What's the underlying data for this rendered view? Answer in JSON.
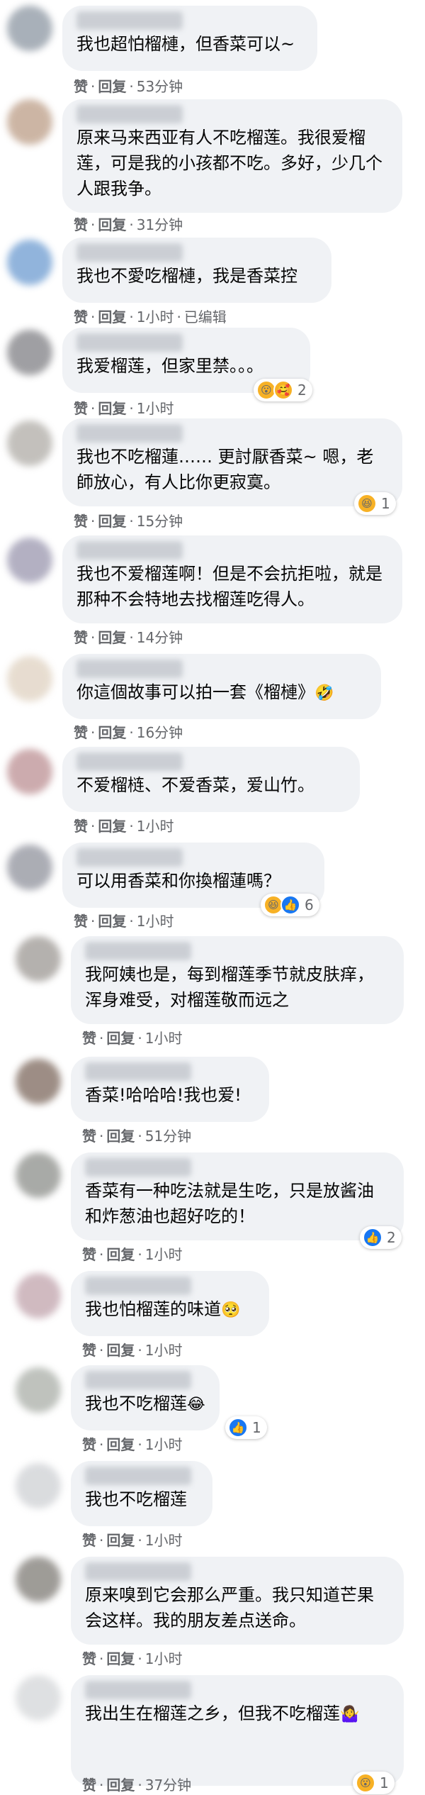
{
  "comments": [
    {
      "text": "我也超怕榴槤，但香菜可以~",
      "actions": [
        "赞",
        "回复"
      ],
      "time": "53分钟",
      "reactions": null
    },
    {
      "text": "原来马来西亚有人不吃榴莲。我很爱榴莲，可是我的小孩都不吃。多好，少几个人跟我争。",
      "actions": [
        "赞",
        "回复"
      ],
      "time": "31分钟",
      "reactions": null
    },
    {
      "text": "我也不愛吃榴槤，我是香菜控",
      "actions": [
        "赞",
        "回复"
      ],
      "time": "1小时",
      "extra": "已编辑",
      "reactions": null
    },
    {
      "text": "我爱榴莲，但家里禁。。。",
      "actions": [
        "赞",
        "回复"
      ],
      "time": "1小时",
      "reactions": {
        "icons": [
          "wow",
          "care"
        ],
        "count": "2"
      }
    },
    {
      "text": "我也不吃榴蓮…… 更討厭香菜~ 嗯，老師放心，有人比你更寂寞。",
      "actions": [
        "赞",
        "回复"
      ],
      "time": "15分钟",
      "reactions": {
        "icons": [
          "haha"
        ],
        "count": "1"
      }
    },
    {
      "text": "我也不爱榴莲啊！但是不会抗拒啦，就是那种不会特地去找榴莲吃得人。",
      "actions": [
        "赞",
        "回复"
      ],
      "time": "14分钟",
      "reactions": null
    },
    {
      "text": "你這個故事可以拍一套《榴槤》",
      "emoji": "🤣",
      "actions": [
        "赞",
        "回复"
      ],
      "time": "16分钟",
      "reactions": null
    },
    {
      "text": "不爱榴梿、不爱香菜，爱山竹。",
      "actions": [
        "赞",
        "回复"
      ],
      "time": "1小时",
      "reactions": null
    },
    {
      "text": "可以用香菜和你換榴蓮嗎？",
      "actions": [
        "赞",
        "回复"
      ],
      "time": "1小时",
      "reactions": {
        "icons": [
          "haha",
          "like"
        ],
        "count": "6"
      }
    },
    {
      "text": "我阿姨也是，每到榴莲季节就皮肤痒，浑身难受，对榴莲敬而远之",
      "actions": [
        "赞",
        "回复"
      ],
      "time": "1小时",
      "reactions": null
    },
    {
      "text": "香菜!哈哈哈!我也爱!",
      "actions": [
        "赞",
        "回复"
      ],
      "time": "51分钟",
      "reactions": null
    },
    {
      "text": "香菜有一种吃法就是生吃，只是放酱油和炸葱油也超好吃的！",
      "actions": [
        "赞",
        "回复"
      ],
      "time": "1小时",
      "reactions": {
        "icons": [
          "like"
        ],
        "count": "2"
      }
    },
    {
      "text": "我也怕榴莲的味道",
      "emoji": "🥺",
      "actions": [
        "赞",
        "回复"
      ],
      "time": "1小时",
      "reactions": null
    },
    {
      "text": "我也不吃榴莲",
      "emoji": "😂",
      "actions": [
        "赞",
        "回复"
      ],
      "time": "1小时",
      "reactions": {
        "icons": [
          "like"
        ],
        "count": "1"
      }
    },
    {
      "text": "我也不吃榴莲",
      "actions": [
        "赞",
        "回复"
      ],
      "time": "1小时",
      "reactions": null
    },
    {
      "text": "原来嗅到它会那么严重。我只知道芒果会这样。我的朋友差点送命。",
      "actions": [
        "赞",
        "回复"
      ],
      "time": "1小时",
      "reactions": null
    },
    {
      "text": "我出生在榴莲之乡，但我不吃榴莲",
      "emoji": "🤷‍♀️",
      "actions": [
        "赞",
        "回复"
      ],
      "time": "37分钟",
      "reactions": {
        "icons": [
          "wow"
        ],
        "count": "1"
      }
    }
  ],
  "colors": {
    "bubble": "#f0f2f5",
    "text": "#050505",
    "meta": "#65676b",
    "like": "#1877f2",
    "emoji_reaction": "#f7b125"
  },
  "reaction_icon_glyphs": {
    "wow": "😮",
    "care": "🥰",
    "haha": "😆",
    "like": "👍"
  }
}
